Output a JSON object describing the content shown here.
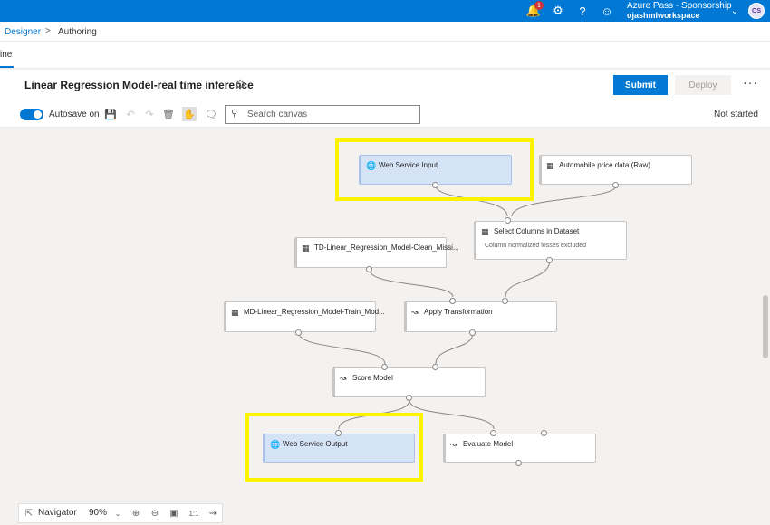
{
  "topbar": {
    "notification_count": "1",
    "account_name": "Azure Pass - Sponsorship",
    "workspace": "ojashmlworkspace",
    "avatar_initials": "OS"
  },
  "breadcrumb": {
    "root": "Designer",
    "separator": ">",
    "current": "Authoring"
  },
  "tab_fragment": "ine",
  "header": {
    "title": "Linear Regression Model-real time inference",
    "submit_label": "Submit",
    "deploy_label": "Deploy",
    "more_label": "···"
  },
  "toolbar": {
    "autosave_label": "Autosave on",
    "search_placeholder": "Search canvas",
    "status": "Not started"
  },
  "nodes": {
    "web_service_input": "Web Service Input",
    "automobile": "Automobile price data (Raw)",
    "select_columns": "Select Columns in Dataset",
    "select_columns_sub": "Column normalized losses excluded",
    "td_clean": "TD-Linear_Regression_Model-Clean_Missi...",
    "md_train": "MD-Linear_Regression_Model-Train_Mod...",
    "apply_transformation": "Apply Transformation",
    "score_model": "Score Model",
    "web_service_output": "Web Service Output",
    "evaluate_model": "Evaluate Model"
  },
  "navigator": {
    "label": "Navigator",
    "zoom": "90%"
  },
  "colors": {
    "accent": "#0078d4",
    "highlight": "#fff200",
    "web_service_node": "#d5e3f7"
  }
}
